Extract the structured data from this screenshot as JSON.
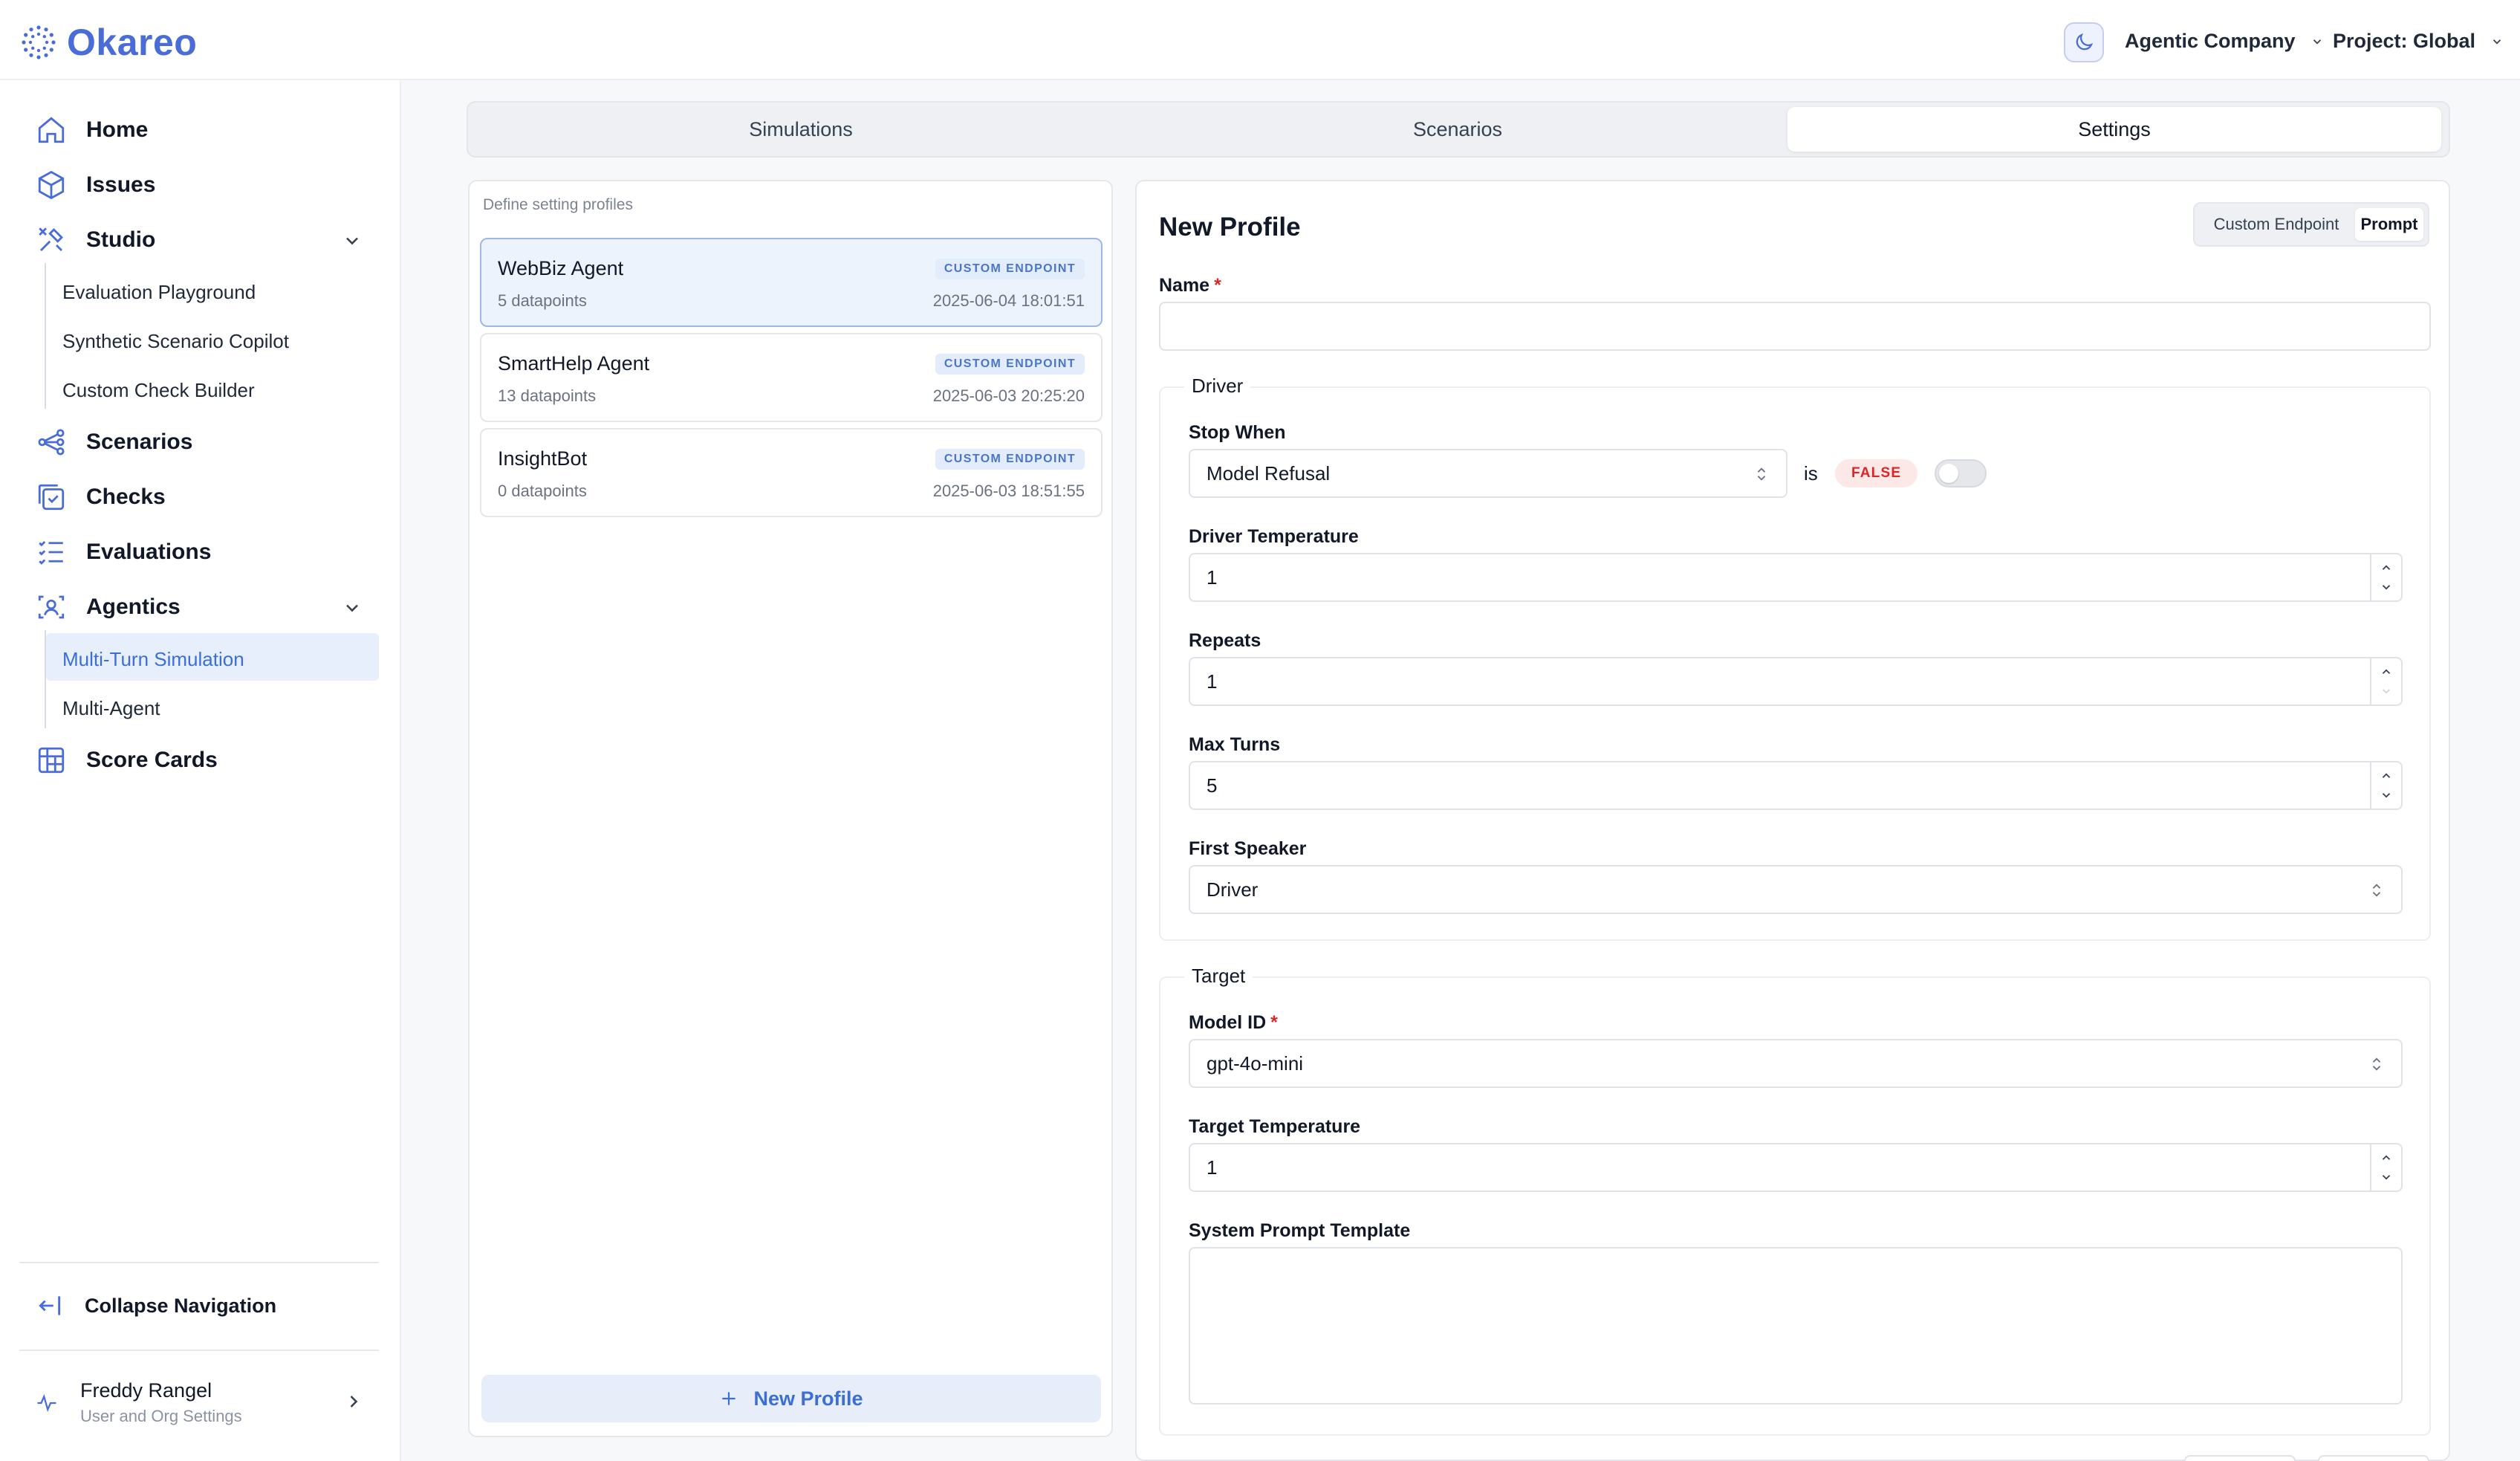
{
  "app": {
    "logo_text": "Okareo"
  },
  "header": {
    "company": "Agentic Company",
    "project": "Project: Global"
  },
  "sidebar": {
    "items": [
      {
        "label": "Home"
      },
      {
        "label": "Issues"
      },
      {
        "label": "Studio"
      },
      {
        "label": "Scenarios"
      },
      {
        "label": "Checks"
      },
      {
        "label": "Evaluations"
      },
      {
        "label": "Agentics"
      },
      {
        "label": "Score Cards"
      }
    ],
    "studio_sub": [
      "Evaluation Playground",
      "Synthetic Scenario Copilot",
      "Custom Check Builder"
    ],
    "agentics_sub": [
      "Multi-Turn Simulation",
      "Multi-Agent"
    ],
    "collapse_label": "Collapse Navigation",
    "user_name": "Freddy Rangel",
    "user_sub": "User and Org Settings"
  },
  "tabs": [
    "Simulations",
    "Scenarios",
    "Settings"
  ],
  "profiles": {
    "caption": "Define setting profiles",
    "items": [
      {
        "name": "WebBiz Agent",
        "badge": "CUSTOM ENDPOINT",
        "count": "5 datapoints",
        "date": "2025-06-04 18:01:51"
      },
      {
        "name": "SmartHelp Agent",
        "badge": "CUSTOM ENDPOINT",
        "count": "13 datapoints",
        "date": "2025-06-03 20:25:20"
      },
      {
        "name": "InsightBot",
        "badge": "CUSTOM ENDPOINT",
        "count": "0 datapoints",
        "date": "2025-06-03 18:51:55"
      }
    ],
    "new_button": "New Profile"
  },
  "form": {
    "title": "New Profile",
    "segment": [
      "Custom Endpoint",
      "Prompt"
    ],
    "name_label": "Name",
    "name_value": "",
    "driver": {
      "legend": "Driver",
      "stop_when_label": "Stop When",
      "stop_when_value": "Model Refusal",
      "is_text": "is",
      "false_badge": "FALSE",
      "driver_temp_label": "Driver Temperature",
      "driver_temp_value": "1",
      "repeats_label": "Repeats",
      "repeats_value": "1",
      "max_turns_label": "Max Turns",
      "max_turns_value": "5",
      "first_speaker_label": "First Speaker",
      "first_speaker_value": "Driver"
    },
    "target": {
      "legend": "Target",
      "model_id_label": "Model ID",
      "model_id_value": "gpt-4o-mini",
      "target_temp_label": "Target Temperature",
      "target_temp_value": "1",
      "system_prompt_label": "System Prompt Template",
      "system_prompt_value": ""
    }
  },
  "colors": {
    "accent": "#4a6cd8",
    "danger": "#dc2626",
    "active_bg": "#e7eefc"
  }
}
